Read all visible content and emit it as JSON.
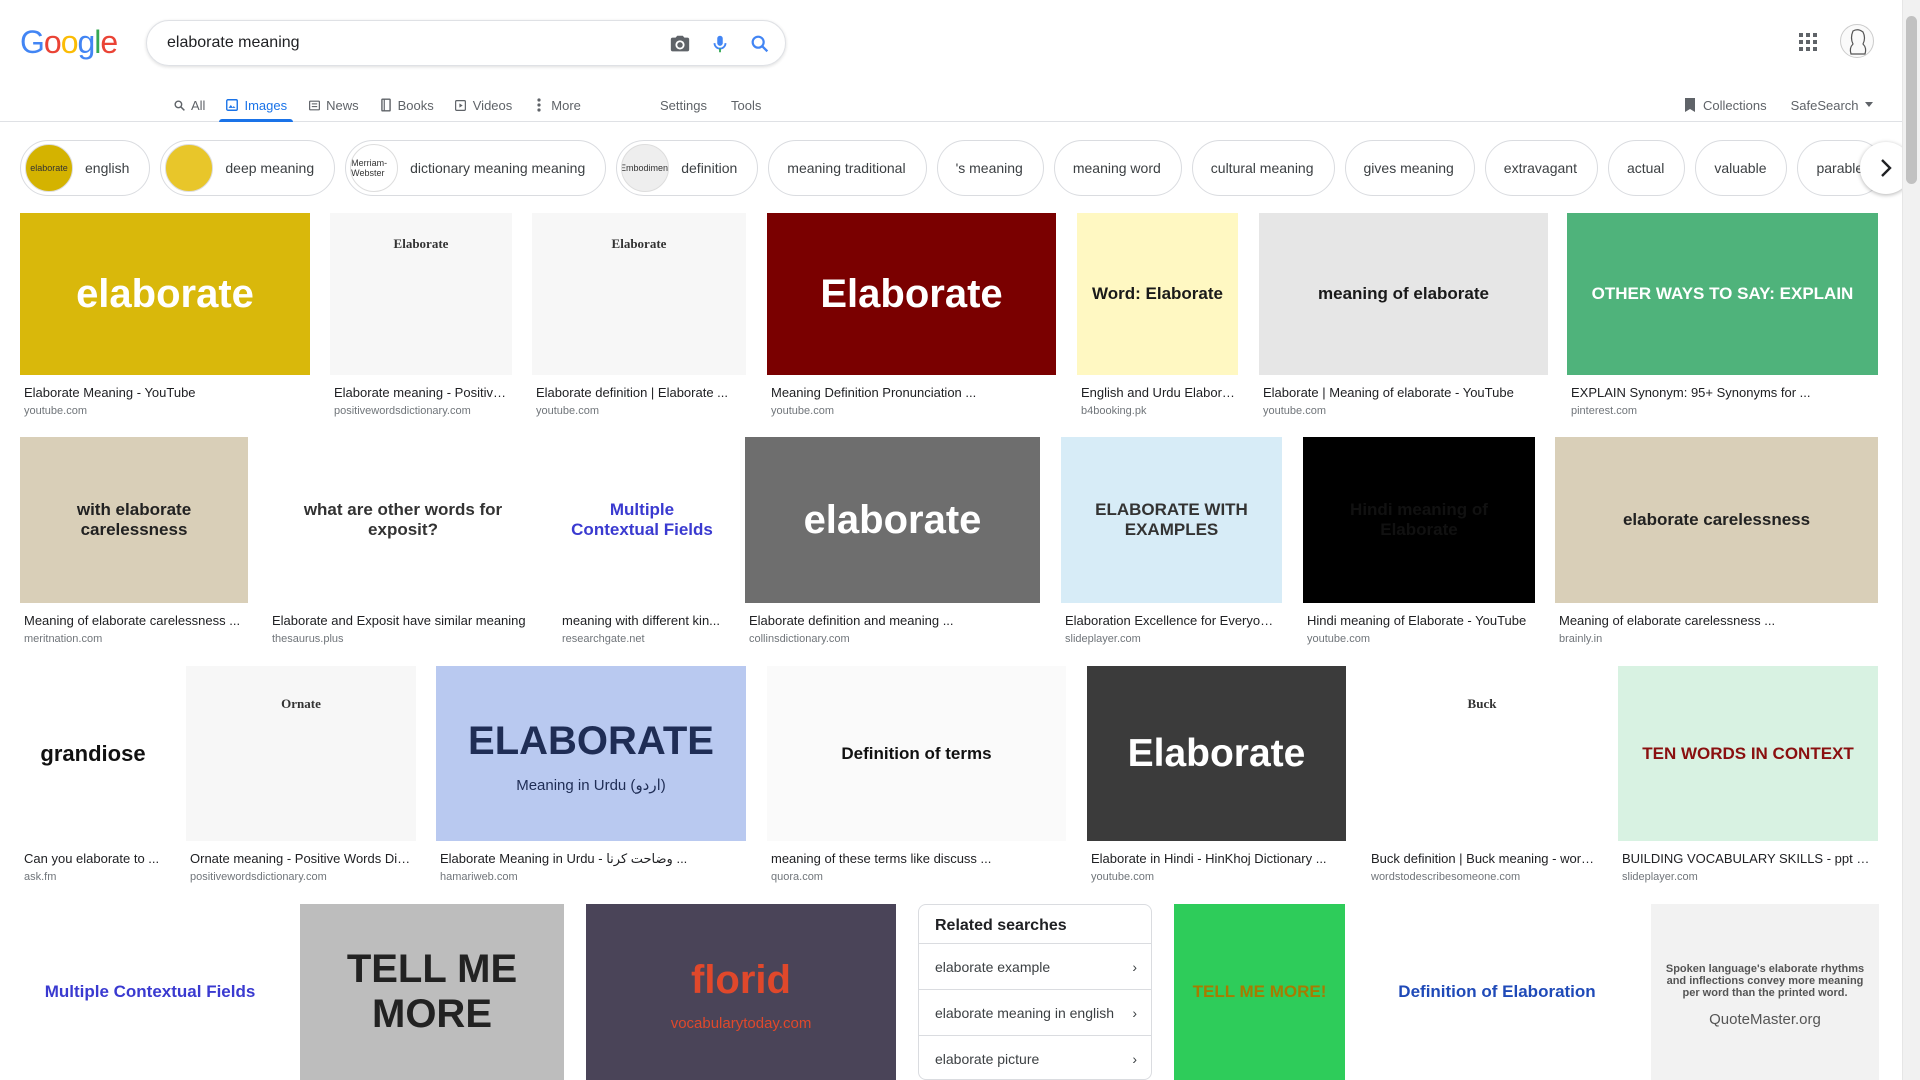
{
  "logo": {
    "letters": [
      "G",
      "o",
      "o",
      "g",
      "l",
      "e"
    ],
    "colors": [
      "#4285f4",
      "#ea4335",
      "#fbbc05",
      "#4285f4",
      "#34a853",
      "#ea4335"
    ]
  },
  "search": {
    "query": "elaborate meaning"
  },
  "tabs": [
    {
      "label": "All",
      "icon": "search-icon",
      "active": false
    },
    {
      "label": "Images",
      "icon": "image-icon",
      "active": true
    },
    {
      "label": "News",
      "icon": "news-icon",
      "active": false
    },
    {
      "label": "Books",
      "icon": "book-icon",
      "active": false
    },
    {
      "label": "Videos",
      "icon": "video-icon",
      "active": false
    },
    {
      "label": "More",
      "icon": "more-vert-icon",
      "active": false
    }
  ],
  "tools": {
    "settings": "Settings",
    "tools": "Tools"
  },
  "right_tools": {
    "collections": "Collections",
    "safesearch": "SafeSearch"
  },
  "chips": [
    {
      "label": "english",
      "thumb": "elaborate",
      "thumb_color": "#d4b300"
    },
    {
      "label": "deep meaning",
      "thumb": "",
      "thumb_color": "#e8c62a"
    },
    {
      "label": "dictionary meaning meaning",
      "thumb": "Merriam-Webster",
      "thumb_color": "#ffffff"
    },
    {
      "label": "definition",
      "thumb": "Embodiment",
      "thumb_color": "#eeeeee"
    },
    {
      "label": "meaning traditional"
    },
    {
      "label": "'s meaning"
    },
    {
      "label": "meaning word"
    },
    {
      "label": "cultural meaning"
    },
    {
      "label": "gives meaning"
    },
    {
      "label": "extravagant"
    },
    {
      "label": "actual"
    },
    {
      "label": "valuable"
    },
    {
      "label": "parable"
    }
  ],
  "row1": [
    {
      "title": "Elaborate Meaning - YouTube",
      "source": "youtube.com",
      "img_text": "elaborate",
      "bg": "#d9b80b",
      "fg": "#ffffff"
    },
    {
      "title": "Elaborate meaning - Positive ...",
      "source": "positivewordsdictionary.com",
      "img_text": "Elaborate",
      "bg": "#f7f7f7",
      "fg": "#333333"
    },
    {
      "title": "Elaborate definition | Elaborate ...",
      "source": "youtube.com",
      "img_text": "Elaborate",
      "bg": "#f7f7f7",
      "fg": "#333333"
    },
    {
      "title": "Meaning Definition Pronunciation ...",
      "source": "youtube.com",
      "img_text": "Elaborate",
      "bg": "#7a0000",
      "fg": "#ffffff"
    },
    {
      "title": "English and Urdu Elabora...",
      "source": "b4booking.pk",
      "img_text": "Word: Elaborate",
      "bg": "#fff8c2",
      "fg": "#1a1a1a"
    },
    {
      "title": "Elaborate | Meaning of elaborate - YouTube",
      "source": "youtube.com",
      "img_text": "meaning of elaborate",
      "bg": "#e6e6e6",
      "fg": "#1a1a1a"
    },
    {
      "title": "EXPLAIN Synonym: 95+ Synonyms for ...",
      "source": "pinterest.com",
      "img_text": "OTHER WAYS TO SAY: EXPLAIN",
      "bg": "#4fb37b",
      "fg": "#ffffff"
    }
  ],
  "row2": [
    {
      "title": "Meaning of elaborate carelessness ...",
      "source": "meritnation.com",
      "img_text": "with elaborate carelessness",
      "bg": "#d9cfb8",
      "fg": "#222222"
    },
    {
      "title": "Elaborate and Exposit have similar meaning",
      "source": "thesaurus.plus",
      "img_text": "what are other words for exposit?",
      "bg": "#ffffff",
      "fg": "#333333"
    },
    {
      "title": "meaning with different kin...",
      "source": "researchgate.net",
      "img_text": "Multiple Contextual Fields",
      "bg": "#ffffff",
      "fg": "#3a3ad0"
    },
    {
      "title": "Elaborate definition and meaning ...",
      "source": "collinsdictionary.com",
      "img_text": "elaborate",
      "bg": "#6e6e6e",
      "fg": "#ffffff"
    },
    {
      "title": "Elaboration Excellence for Everyone...",
      "source": "slideplayer.com",
      "img_text": "ELABORATE WITH EXAMPLES",
      "bg": "#d7ecf7",
      "fg": "#333333"
    },
    {
      "title": "Hindi meaning of Elaborate - YouTube",
      "source": "youtube.com",
      "img_text": "Hindi meaning of Elaborate",
      "bg": "#000000",
      "fg": "#111111"
    },
    {
      "title": "Meaning of elaborate carelessness ...",
      "source": "brainly.in",
      "img_text": "elaborate carelessness",
      "bg": "#d9cfb8",
      "fg": "#222222"
    }
  ],
  "row3": [
    {
      "title": "Can you elaborate to ...",
      "source": "ask.fm",
      "img_text": "grandiose",
      "bg": "#ffffff",
      "fg": "#111111"
    },
    {
      "title": "Ornate meaning - Positive Words Dict...",
      "source": "positivewordsdictionary.com",
      "img_text": "Ornate",
      "bg": "#f7f7f7",
      "fg": "#333333"
    },
    {
      "title": "Elaborate Meaning in Urdu - وضاحت کرنا ...",
      "source": "hamariweb.com",
      "img_text": "ELABORATE",
      "sub": "Meaning in Urdu (اردو)",
      "bg": "#b9c9f0",
      "fg": "#1f2d55"
    },
    {
      "title": "meaning of these terms like discuss ...",
      "source": "quora.com",
      "img_text": "Definition of terms",
      "bg": "#fafafa",
      "fg": "#111111"
    },
    {
      "title": "Elaborate in Hindi - HinKhoj Dictionary ...",
      "source": "youtube.com",
      "img_text": "Elaborate",
      "bg": "#3b3b3b",
      "fg": "#ffffff"
    },
    {
      "title": "Buck definition | Buck meaning - word...",
      "source": "wordstodescribesomeone.com",
      "img_text": "Buck",
      "bg": "#ffffff",
      "fg": "#333333"
    },
    {
      "title": "BUILDING VOCABULARY SKILLS - ppt do...",
      "source": "slideplayer.com",
      "img_text": "TEN WORDS IN CONTEXT",
      "bg": "#d8f2e2",
      "fg": "#8a1010"
    }
  ],
  "row4": [
    {
      "img_text": "Multiple Contextual Fields",
      "bg": "#ffffff",
      "fg": "#3a3ad0"
    },
    {
      "img_text": "TELL ME MORE",
      "bg": "#bdbdbd",
      "fg": "#222222"
    },
    {
      "img_text": "florid",
      "sub": "vocabularytoday.com",
      "bg": "#4a4458",
      "fg": "#e0482b"
    },
    {
      "img_text": "TELL ME MORE!",
      "bg": "#2ecc5a",
      "fg": "#a77b00"
    },
    {
      "img_text": "Definition of Elaboration",
      "bg": "#ffffff",
      "fg": "#1f4ab8"
    },
    {
      "img_text": "Spoken language's elaborate rhythms and inflections convey more meaning per word than the printed word.",
      "sub": "QuoteMaster.org",
      "bg": "#f2f2f2",
      "fg": "#555555"
    }
  ],
  "related": {
    "heading": "Related searches",
    "items": [
      "elaborate example",
      "elaborate meaning in english",
      "elaborate picture"
    ]
  }
}
